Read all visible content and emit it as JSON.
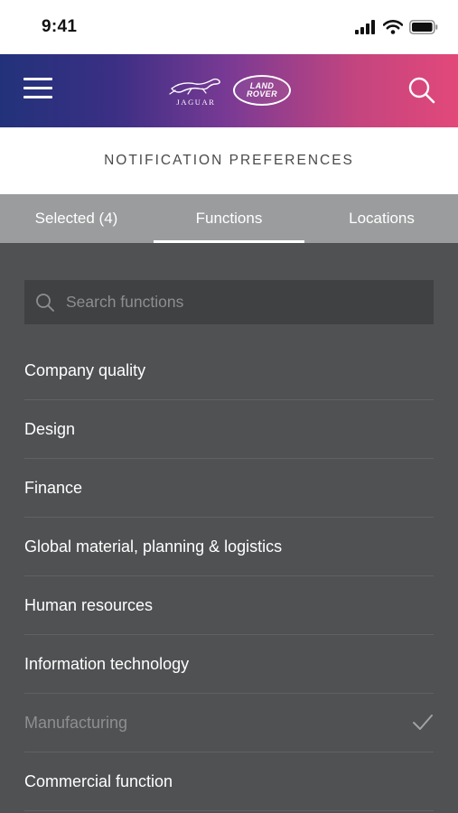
{
  "status_bar": {
    "time": "9:41"
  },
  "header": {
    "brand_left": "JAGUAR",
    "brand_right_line1": "LAND",
    "brand_right_line2": "ROVER"
  },
  "page": {
    "title": "NOTIFICATION PREFERENCES"
  },
  "tabs": [
    {
      "label": "Selected (4)",
      "active": false
    },
    {
      "label": "Functions",
      "active": true
    },
    {
      "label": "Locations",
      "active": false
    }
  ],
  "search": {
    "placeholder": "Search functions",
    "value": ""
  },
  "functions": [
    {
      "label": "Company quality",
      "selected": false
    },
    {
      "label": "Design",
      "selected": false
    },
    {
      "label": "Finance",
      "selected": false
    },
    {
      "label": "Global material, planning & logistics",
      "selected": false
    },
    {
      "label": "Human resources",
      "selected": false
    },
    {
      "label": "Information technology",
      "selected": false
    },
    {
      "label": "Manufacturing",
      "selected": true
    },
    {
      "label": "Commercial function",
      "selected": false
    }
  ],
  "icons": {
    "menu": "menu-icon",
    "search": "search-icon",
    "check": "check-icon",
    "signal": "signal-icon",
    "wifi": "wifi-icon",
    "battery": "battery-icon"
  },
  "colors": {
    "header_gradient_start": "#22327a",
    "header_gradient_end": "#e2487a",
    "tab_bar": "#9a9c9d",
    "list_background": "#4f5153"
  }
}
